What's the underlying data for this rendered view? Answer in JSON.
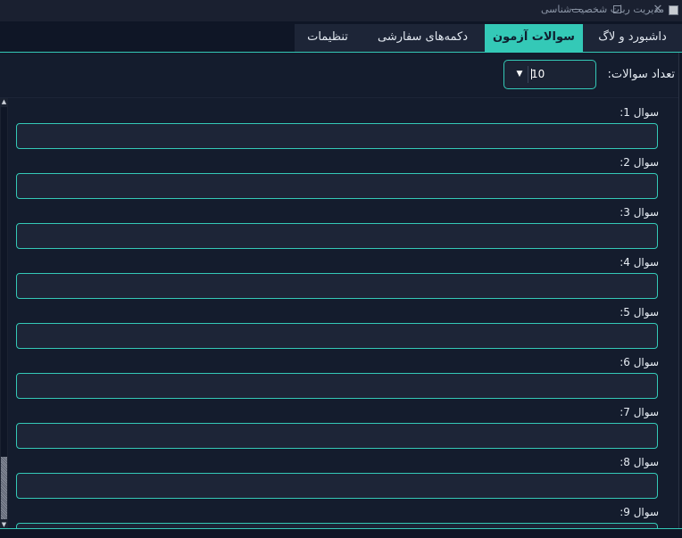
{
  "window": {
    "title": "مدیریت ربات شخصیت‌شناسی",
    "minimize": "—",
    "close": "✕"
  },
  "tabs": [
    {
      "label": "داشبورد و لاگ",
      "active": false
    },
    {
      "label": "سوالات آزمون",
      "active": true
    },
    {
      "label": "دکمه‌های سفارشی",
      "active": false
    },
    {
      "label": "تنظیمات",
      "active": false
    }
  ],
  "count": {
    "label": "تعداد سوالات:",
    "value": "10"
  },
  "questions": [
    {
      "label": "سوال 1:",
      "value": ""
    },
    {
      "label": "سوال 2:",
      "value": ""
    },
    {
      "label": "سوال 3:",
      "value": ""
    },
    {
      "label": "سوال 4:",
      "value": ""
    },
    {
      "label": "سوال 5:",
      "value": ""
    },
    {
      "label": "سوال 6:",
      "value": ""
    },
    {
      "label": "سوال 7:",
      "value": ""
    },
    {
      "label": "سوال 8:",
      "value": ""
    },
    {
      "label": "سوال 9:",
      "value": ""
    }
  ],
  "colors": {
    "accent": "#34c9b7",
    "background": "#0f1626",
    "panel": "#141c2d",
    "field": "#1d2537"
  },
  "icons": {
    "app": "app-icon",
    "spin": "chevron-down-icon",
    "scroll_up": "chevron-up-icon",
    "scroll_down": "chevron-down-icon"
  }
}
